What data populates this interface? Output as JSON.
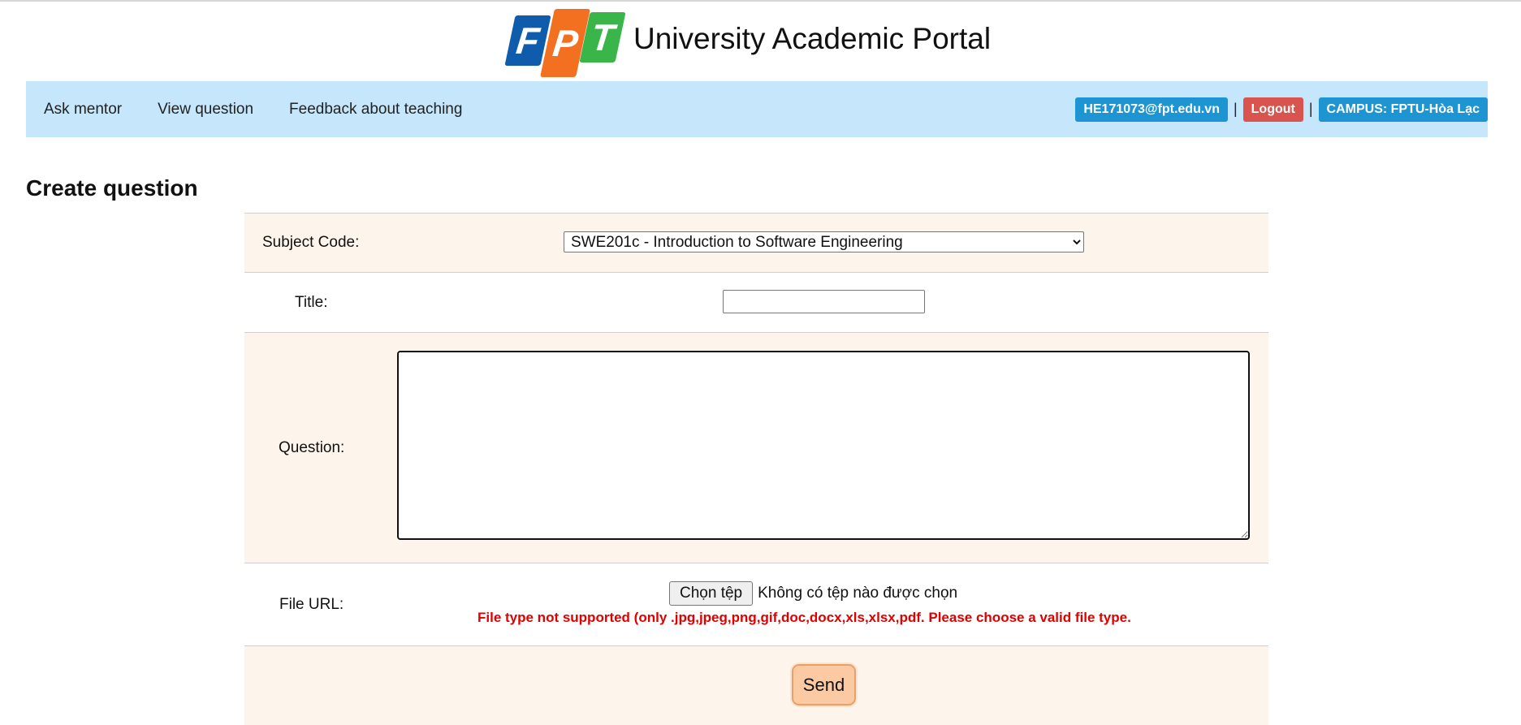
{
  "header": {
    "logo_letters": [
      "F",
      "P",
      "T"
    ],
    "logo_colors": [
      "#0f5cad",
      "#f37021",
      "#39b54a"
    ],
    "title": "University Academic Portal"
  },
  "nav": {
    "links": [
      "Ask mentor",
      "View question",
      "Feedback about teaching"
    ],
    "user_email": "HE171073@fpt.edu.vn",
    "logout_label": "Logout",
    "separator": "|",
    "campus": "CAMPUS: FPTU-Hòa Lạc",
    "bar_color": "#c5e6fb"
  },
  "page": {
    "heading": "Create question"
  },
  "form": {
    "subject_label": "Subject Code:",
    "subject_value": "SWE201c - Introduction to Software Engineering",
    "title_label": "Title:",
    "title_value": "",
    "question_label": "Question:",
    "question_value": "",
    "file_label": "File URL:",
    "file_button": "Chọn tệp",
    "file_status": "Không có tệp nào được chọn",
    "file_error": "File type not supported (only .jpg,jpeg,png,gif,doc,docx,xls,xlsx,pdf. Please choose a valid file type.",
    "send_label": "Send"
  }
}
